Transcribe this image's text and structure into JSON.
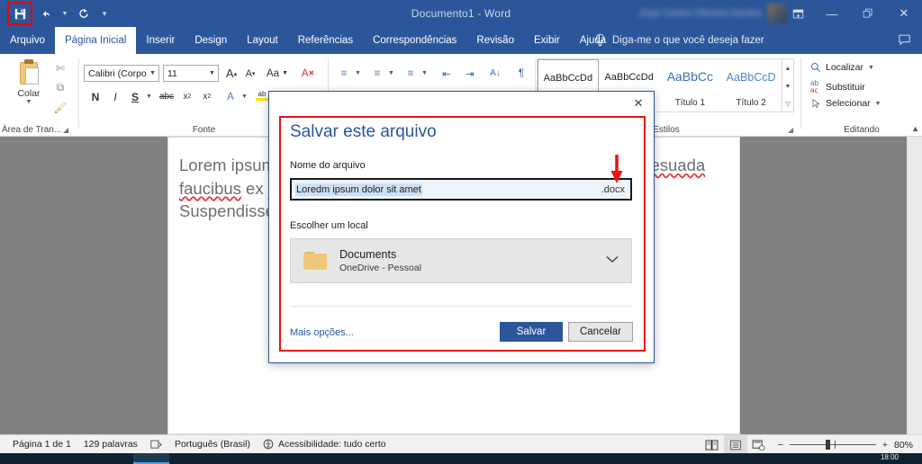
{
  "titlebar": {
    "document_title": "Documento1  -  Word",
    "quick_access": [
      {
        "name": "save",
        "glyph": "💾",
        "highlighted": true
      },
      {
        "name": "undo",
        "glyph": "↶"
      },
      {
        "name": "redo",
        "glyph": "↻"
      }
    ],
    "account_name": "Joao Carlos Oliveira Santos",
    "window_buttons": [
      {
        "name": "ribbon-display-options",
        "glyph": "⬚"
      },
      {
        "name": "minimize",
        "glyph": "—"
      },
      {
        "name": "restore",
        "glyph": "❐"
      },
      {
        "name": "close",
        "glyph": "✕"
      }
    ]
  },
  "ribbon": {
    "tabs": [
      {
        "label": "Arquivo",
        "active": false
      },
      {
        "label": "Página Inicial",
        "active": true
      },
      {
        "label": "Inserir",
        "active": false
      },
      {
        "label": "Design",
        "active": false
      },
      {
        "label": "Layout",
        "active": false
      },
      {
        "label": "Referências",
        "active": false
      },
      {
        "label": "Correspondências",
        "active": false
      },
      {
        "label": "Revisão",
        "active": false
      },
      {
        "label": "Exibir",
        "active": false
      },
      {
        "label": "Ajuda",
        "active": false
      }
    ],
    "tell_me": "Diga-me o que você deseja fazer",
    "groups": {
      "clipboard": {
        "label": "Área de Tran...",
        "paste_label": "Colar",
        "cut_glyph": "✂",
        "copy_glyph": "⧉",
        "format_painter_glyph": "✎"
      },
      "font": {
        "label": "Fonte",
        "font_name": "Calibri (Corpo",
        "font_size": "11",
        "grow_font": "A",
        "shrink_font": "A",
        "change_case": "Aa",
        "clear_format": "A",
        "bold": "N",
        "italic": "I",
        "underline": "S",
        "strikethrough": "abc",
        "subscript": "x₂",
        "superscript": "x²",
        "text_effects": "A",
        "highlight": "ab"
      },
      "paragraph": {
        "label": "",
        "bullets": "☰",
        "numbering": "☰",
        "multilevel": "☰",
        "decrease_indent": "⇤",
        "increase_indent": "⇥",
        "sort": "A↓",
        "show_marks": "¶"
      },
      "styles": {
        "label": "Estilos",
        "items": [
          {
            "preview": "AaBbCcDd",
            "name": "",
            "selected": true,
            "kind": "normal"
          },
          {
            "preview": "AaBbCcDd",
            "name": "",
            "selected": false,
            "kind": "normal"
          },
          {
            "preview": "AaBbCc",
            "name": "Título 1",
            "selected": false,
            "kind": "h1"
          },
          {
            "preview": "AaBbCcD",
            "name": "Título 2",
            "selected": false,
            "kind": "h2"
          }
        ]
      },
      "editing": {
        "label": "Editando",
        "items": [
          {
            "label": "Localizar",
            "icon": "search-icon",
            "glyph": "🔍",
            "caret": true
          },
          {
            "label": "Substituir",
            "icon": "replace-icon",
            "glyph": "ab",
            "caret": false
          },
          {
            "label": "Selecionar",
            "icon": "select-icon",
            "glyph": "↖",
            "caret": true
          }
        ]
      }
    }
  },
  "document": {
    "paragraph": "Lorem ipsum dolor sit amet, consectetur adipiscing elit. Sed malesuada faucibus ex nec ultricies. Donec mattis egestas nisi non pretium. Suspendisse nec eros ut erat facilisis maximus",
    "misspelled_words": [
      "amet",
      "consectetur",
      "adipiscing",
      "malesuada",
      "faucibus",
      "nec",
      "ultricies",
      "Donec",
      "mattis",
      "egestas",
      "nisi",
      "pretium"
    ]
  },
  "save_dialog": {
    "title": "Salvar este arquivo",
    "close_glyph": "✕",
    "filename_label": "Nome do arquivo",
    "filename_value": "Loredm ipsum dolor sit amet",
    "filename_extension": ".docx",
    "location_label": "Escolher um local",
    "location_name": "Documents",
    "location_sub": "OneDrive - Pessoal",
    "location_caret": "⌄",
    "more_options_label": "Mais opções...",
    "save_button": "Salvar",
    "cancel_button": "Cancelar",
    "annotation_color": "#ee1111"
  },
  "statusbar": {
    "page_info": "Página 1 de 1",
    "word_count": "129 palavras",
    "proofing_glyph": "▣",
    "language": "Português (Brasil)",
    "accessibility_glyph": "♿",
    "accessibility": "Acessibilidade: tudo certo",
    "views": [
      {
        "name": "read-mode",
        "glyph": "▤",
        "active": false
      },
      {
        "name": "print-layout",
        "glyph": "▤",
        "active": true
      },
      {
        "name": "web-layout",
        "glyph": "▤",
        "active": false
      }
    ],
    "zoom_out": "−",
    "zoom_in": "+",
    "zoom_level": "80%"
  },
  "taskbar": {
    "clock": "18:00"
  },
  "colors": {
    "word_blue": "#2b579a",
    "annotation_red": "#ee1111",
    "doc_gray": "#818181"
  }
}
